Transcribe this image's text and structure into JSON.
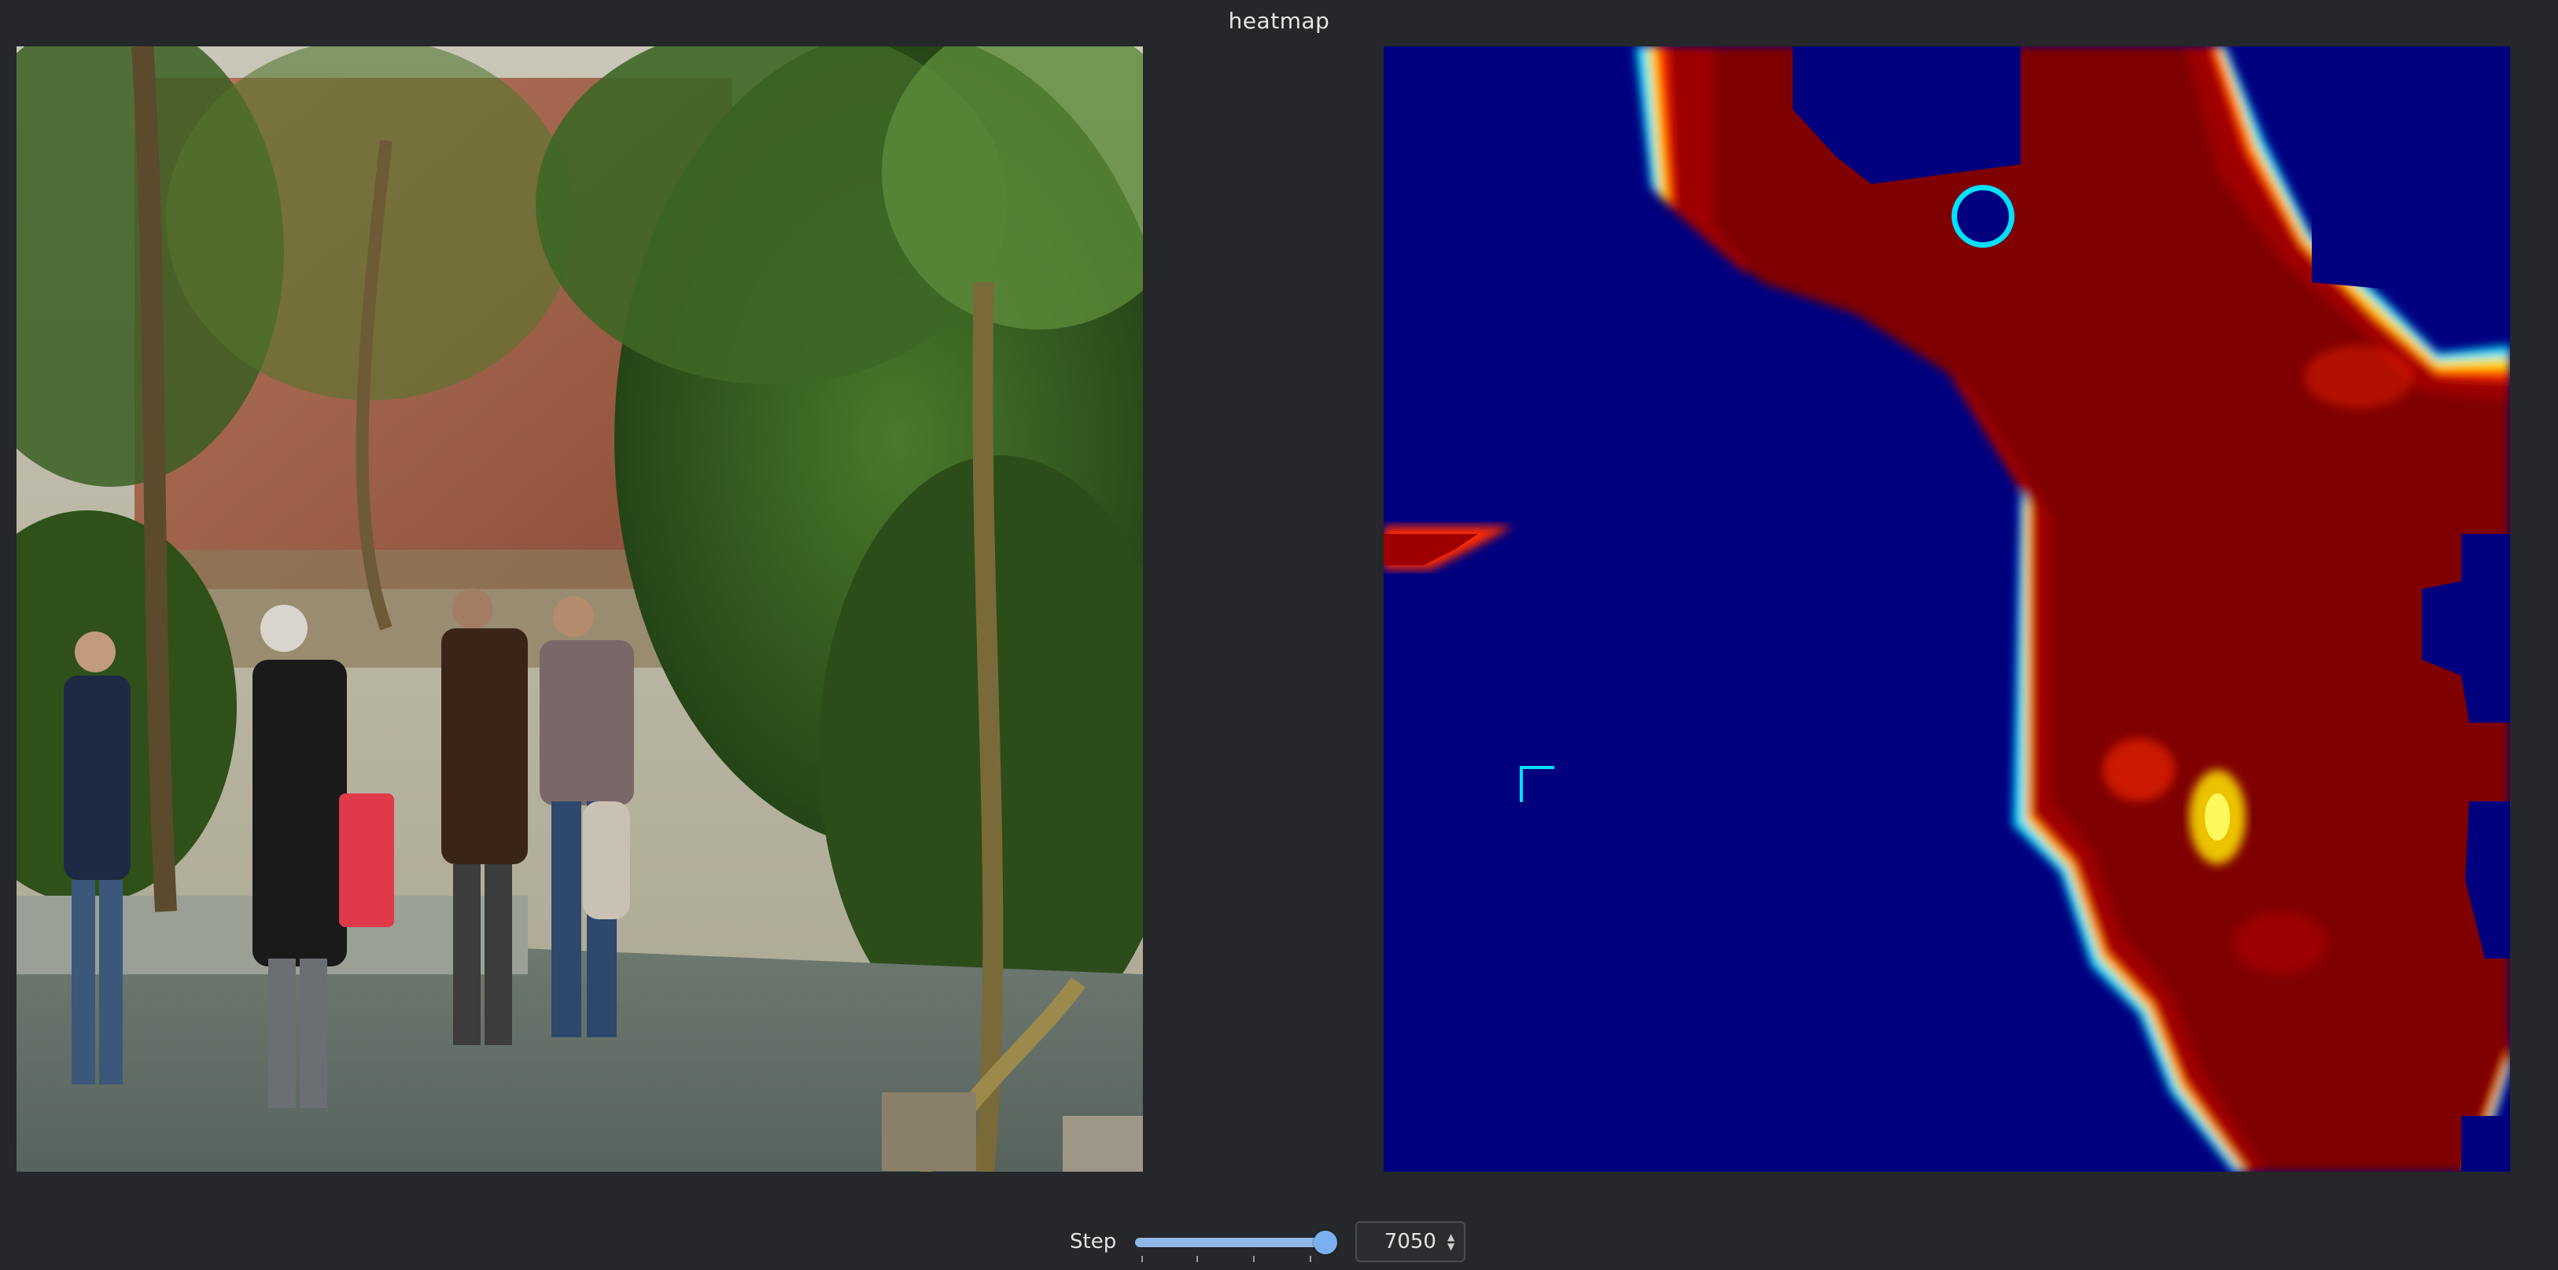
{
  "window": {
    "title": "heatmap"
  },
  "photo_panel": {
    "description": "street photo of four people beside trees and a brick wall"
  },
  "heatmap_panel": {
    "colormap": "jet",
    "colors": {
      "background": "#00007f",
      "hot": "#8b0000",
      "mid": "#ff2a00",
      "warm": "#ffd700",
      "cool": "#00d4ff"
    }
  },
  "controls": {
    "step_label": "Step",
    "slider_value_fraction": 1.0,
    "spin_value": "7050"
  }
}
